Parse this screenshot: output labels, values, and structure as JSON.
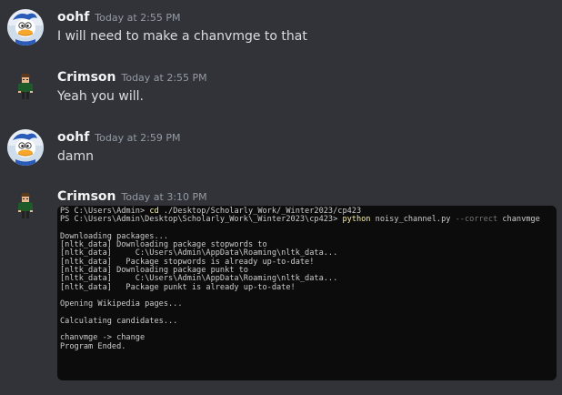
{
  "messages": [
    {
      "username": "oohf",
      "timestamp": "Today at 2:55 PM",
      "text": "I will need to make a chanvmge to that",
      "avatar": "duck-avatar-icon"
    },
    {
      "username": "Crimson",
      "timestamp": "Today at 2:55 PM",
      "text": "Yeah you will.",
      "avatar": "pixel-character-avatar-icon"
    },
    {
      "username": "oohf",
      "timestamp": "Today at 2:59 PM",
      "text": "damn",
      "avatar": "duck-avatar-icon"
    },
    {
      "username": "Crimson",
      "timestamp": "Today at 3:10 PM",
      "avatar": "pixel-character-avatar-icon",
      "terminal": {
        "line1": {
          "prompt": "PS C:\\Users\\Admin> ",
          "cmd": "cd",
          "args": " ./Desktop/Scholarly_Work/_Winter2023/cp423"
        },
        "line2": {
          "prompt": "PS C:\\Users\\Admin\\Desktop\\Scholarly_Work\\_Winter2023\\cp423> ",
          "cmd": "python",
          "args": " noisy_channel.py ",
          "flag": "--correct",
          "arg2": " chanvmge"
        },
        "output": [
          "",
          "Downloading packages...",
          "[nltk_data] Downloading package stopwords to",
          "[nltk_data]     C:\\Users\\Admin\\AppData\\Roaming\\nltk_data...",
          "[nltk_data]   Package stopwords is already up-to-date!",
          "[nltk_data] Downloading package punkt to",
          "[nltk_data]     C:\\Users\\Admin\\AppData\\Roaming\\nltk_data...",
          "[nltk_data]   Package punkt is already up-to-date!",
          "",
          "Opening Wikipedia pages...",
          "",
          "Calculating candidates...",
          "",
          "chanvmge -> change",
          "Program Ended."
        ]
      }
    }
  ],
  "colors": {
    "background": "#313338",
    "username": "#f2f3f5",
    "timestamp": "#949ba4",
    "text": "#dbdee1",
    "terminal_bg": "#0c0c0c",
    "terminal_text": "#cccccc",
    "terminal_command": "#f9f1a5"
  }
}
